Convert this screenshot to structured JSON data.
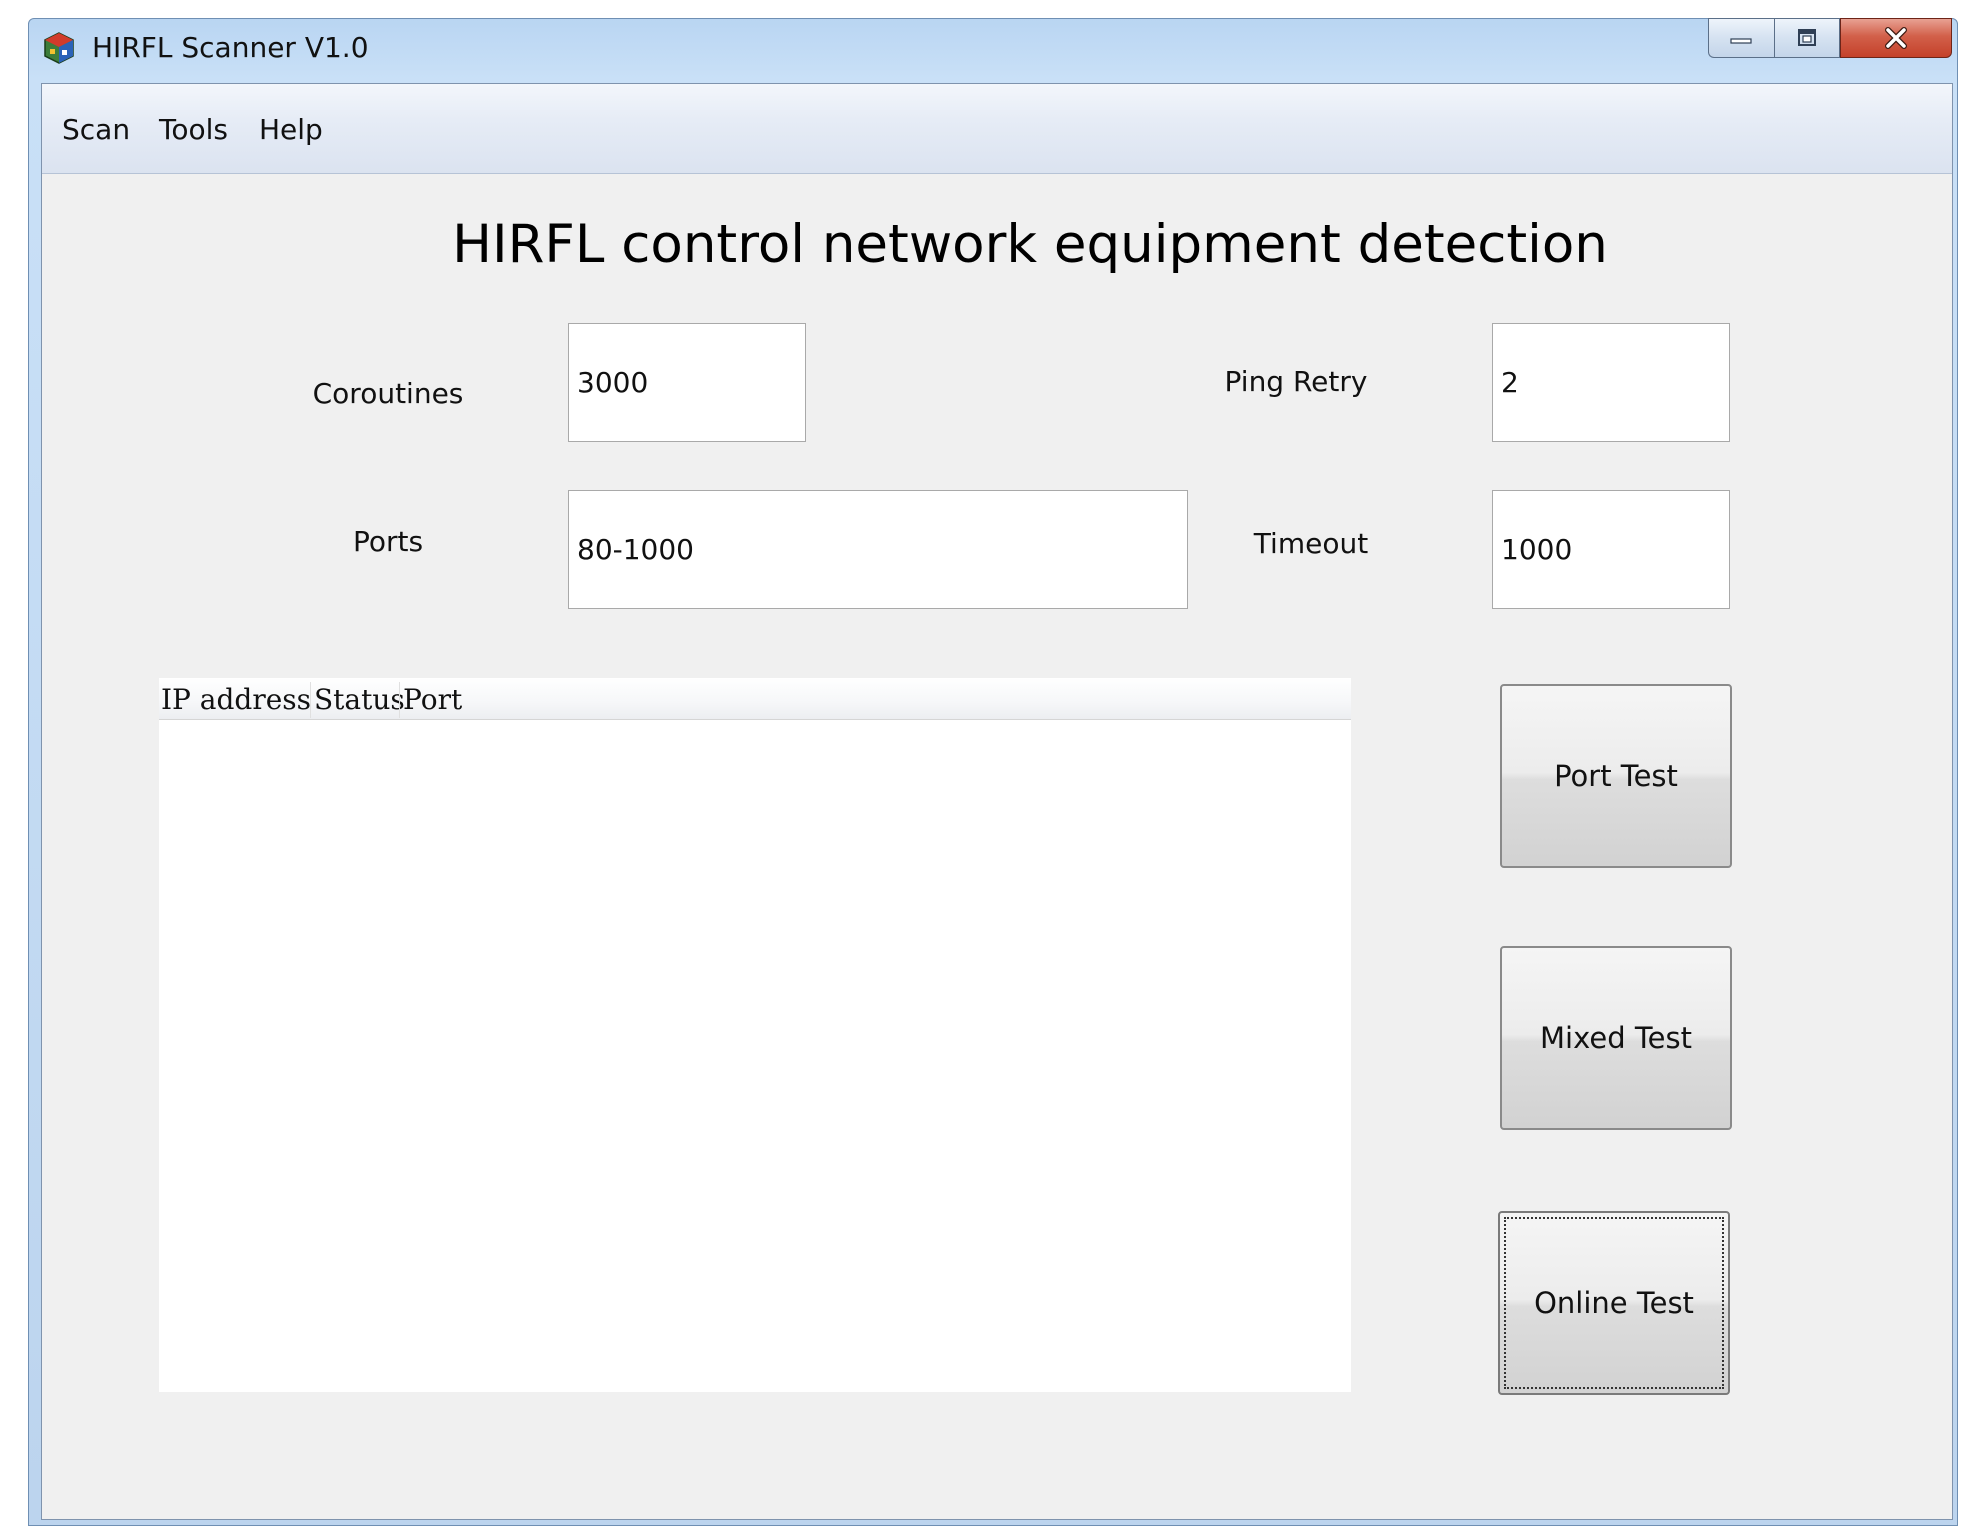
{
  "window": {
    "title": "HIRFL Scanner V1.0"
  },
  "menu": {
    "items": [
      "Scan",
      "Tools",
      "Help"
    ]
  },
  "main": {
    "heading": "HIRFL control network equipment detection",
    "coroutines": {
      "label": "Coroutines",
      "value": "3000"
    },
    "ping_retry": {
      "label": "Ping Retry",
      "value": "2"
    },
    "ports": {
      "label": "Ports",
      "value": "80-1000"
    },
    "timeout": {
      "label": "Timeout",
      "value": "1000"
    },
    "table": {
      "columns": [
        "IP address",
        "Status",
        "Port"
      ],
      "rows": []
    },
    "buttons": {
      "port_test": "Port Test",
      "mixed_test": "Mixed Test",
      "online_test": "Online Test"
    }
  },
  "icons": {
    "app": "network-scanner-icon",
    "minimize": "minimize-icon",
    "maximize": "restore-icon",
    "close": "close-icon"
  }
}
